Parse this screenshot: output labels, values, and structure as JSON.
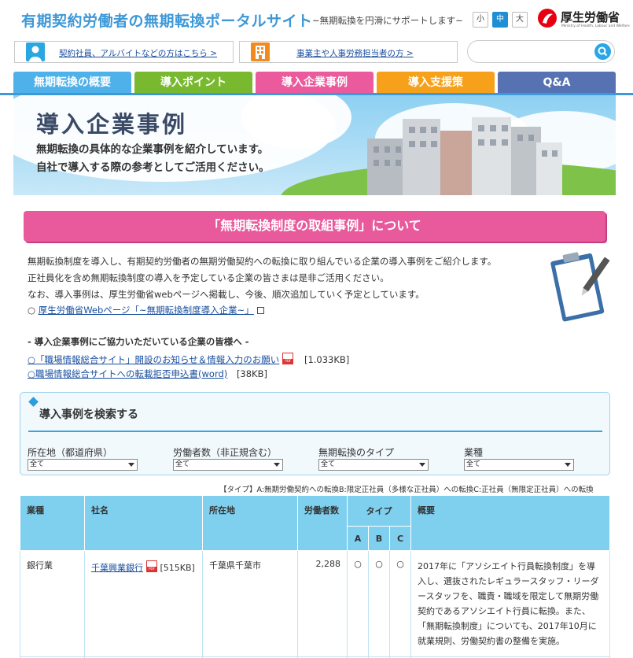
{
  "header": {
    "site_title": "有期契約労働者の無期転換ポータルサイト",
    "site_subtitle": "~無期転換を円滑にサポートします~",
    "font_sizes": [
      "小",
      "中",
      "大"
    ],
    "ministry_name": "厚生労働省",
    "ministry_en": "Ministry of Health, Labour and Welfare"
  },
  "top_links": {
    "workers": "契約社員、アルバイトなどの方はこちら >",
    "employers": "事業主や人事労務担当者の方 >",
    "search_placeholder": ""
  },
  "nav": {
    "tabs": [
      {
        "label": "無期転換の概要",
        "color": "#4fb1ea"
      },
      {
        "label": "導入ポイント",
        "color": "#79b92f"
      },
      {
        "label": "導入企業事例",
        "color": "#ea5a9c"
      },
      {
        "label": "導入支援策",
        "color": "#f7a01a"
      },
      {
        "label": "Q&A",
        "color": "#5672b3"
      }
    ]
  },
  "hero": {
    "title": "導入企業事例",
    "line1": "無期転換の具体的な企業事例を紹介しています。",
    "line2": "自社で導入する際の参考としてご活用ください。"
  },
  "section": {
    "heading": "「無期転換制度の取組事例」について",
    "intro": [
      "無期転換制度を導入し、有期契約労働者の無期労働契約への転換に取り組んでいる企業の導入事例をご紹介します。",
      "正社員化を含め無期転換制度の導入を予定している企業の皆さまは是非ご活用ください。",
      "なお、導入事例は、厚生労働省webページへ掲載し、今後、順次追加していく予定としています。"
    ],
    "mhlw_link_prefix": "○ ",
    "mhlw_link": "厚生労働省Webページ「~無期転換制度導入企業~」",
    "cooperation_title": "- 導入企業事例にご協力いただいている企業の皆様へ -",
    "doc1_label": "○「職場情報総合サイト」開設のお知らせ＆情報入力のお願い",
    "doc1_size": "[1.033KB]",
    "doc2_label": "○職場情報総合サイトへの転載拒否申込書(word)",
    "doc2_size": "[38KB]",
    "pdf_text": "PDF"
  },
  "search": {
    "title": "導入事例を検索する",
    "filters": [
      {
        "label": "所在地（都道府県）",
        "value": "全て"
      },
      {
        "label": "労働者数（非正規含む）",
        "value": "全て"
      },
      {
        "label": "無期転換のタイプ",
        "value": "全て"
      },
      {
        "label": "業種",
        "value": "全て"
      }
    ]
  },
  "type_note": "【タイプ】A:無期労働契約への転換B:限定正社員（多様な正社員）への転換C:正社員（無限定正社員）への転換",
  "table": {
    "headers": {
      "industry": "業種",
      "company": "社名",
      "location": "所在地",
      "workers": "労働者数",
      "type": "タイプ",
      "a": "A",
      "b": "B",
      "c": "C",
      "summary": "概要"
    },
    "rows": [
      {
        "industry": "銀行業",
        "company": "千葉興業銀行",
        "company_size": "[515KB]",
        "location": "千葉県千葉市",
        "workers": "2,288",
        "a": "○",
        "b": "○",
        "c": "○",
        "summary": "2017年に「アソシエイト行員転換制度」を導入し、選抜されたレギュラースタッフ・リーダースタッフを、職責・職域を限定して無期労働契約であるアソシエイト行員に転換。また、「無期転換制度」についても、2017年10月に就業規則、労働契約書の整備を実施。"
      }
    ]
  }
}
